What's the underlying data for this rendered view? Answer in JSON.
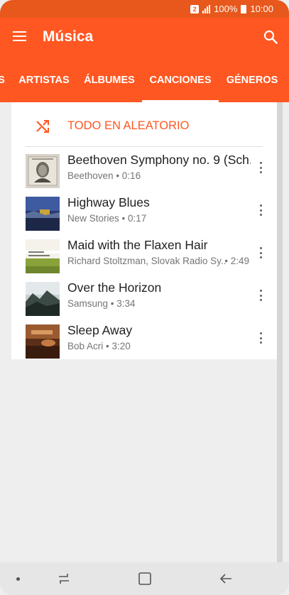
{
  "status_bar": {
    "badge": "2",
    "battery": "100%",
    "time": "10:00"
  },
  "app_bar": {
    "title": "Música",
    "icons": [
      "menu-icon",
      "search-icon"
    ]
  },
  "tabs": [
    {
      "label": "S",
      "selected": false
    },
    {
      "label": "ARTISTAS",
      "selected": false
    },
    {
      "label": "ÁLBUMES",
      "selected": false
    },
    {
      "label": "CANCIONES",
      "selected": true
    },
    {
      "label": "GÉNEROS",
      "selected": false
    }
  ],
  "shuffle": {
    "label": "TODO EN ALEATORIO"
  },
  "songs": [
    {
      "title": "Beethoven Symphony no. 9 (Sch..",
      "artist": "Beethoven",
      "duration": "0:16"
    },
    {
      "title": "Highway Blues",
      "artist": "New Stories",
      "duration": "0:17"
    },
    {
      "title": "Maid with the Flaxen Hair",
      "artist": "Richard Stoltzman, Slovak Radio Sy..",
      "duration": "2:49"
    },
    {
      "title": "Over the Horizon",
      "artist": "Samsung",
      "duration": "3:34"
    },
    {
      "title": "Sleep Away",
      "artist": "Bob Acri",
      "duration": "3:20"
    }
  ],
  "separator": " • ",
  "colors": {
    "accent": "#ff5722",
    "status_bar": "#e8581c"
  }
}
